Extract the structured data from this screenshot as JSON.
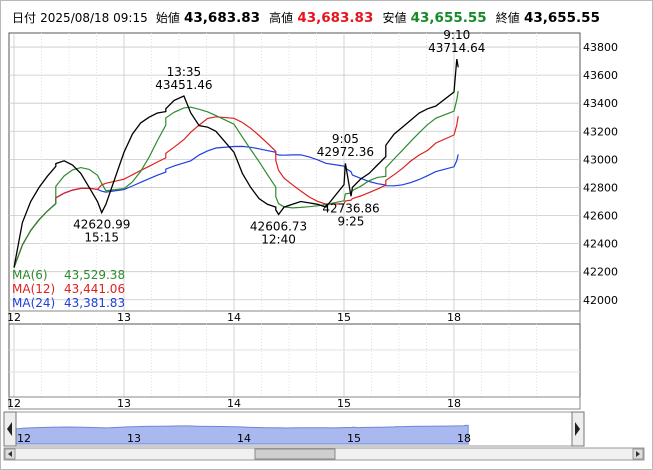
{
  "header": {
    "date_label": "日付",
    "datetime": "2025/08/18 09:15",
    "open_label": "始値",
    "open": "43,683.83",
    "high_label": "高値",
    "high": "43,683.83",
    "low_label": "安値",
    "low": "43,655.55",
    "close_label": "終値",
    "close": "43,655.55"
  },
  "colors": {
    "price": "#000000",
    "ma6": "#2e8b2e",
    "ma12": "#e02020",
    "ma24": "#1f3fe0",
    "navigator_fill": "#aab8f0",
    "grid": "#c8c8c8"
  },
  "legend": [
    {
      "name": "MA(6)",
      "value": "43,529.38",
      "color": "#2e8b2e"
    },
    {
      "name": "MA(12)",
      "value": "43,441.06",
      "color": "#e02020"
    },
    {
      "name": "MA(24)",
      "value": "43,381.83",
      "color": "#1f3fe0"
    }
  ],
  "chart_data": {
    "type": "line",
    "x_type": "intraday",
    "day_labels": [
      "12",
      "13",
      "14",
      "15",
      "18"
    ],
    "y_ticks": [
      42000,
      42200,
      42400,
      42600,
      42800,
      43000,
      43200,
      43400,
      43600,
      43800
    ],
    "ylim": [
      41920,
      43900
    ],
    "grid": true,
    "x": [
      "08/12 09:00",
      "08/12 09:30",
      "08/12 10:00",
      "08/12 10:30",
      "08/12 11:00",
      "08/12 11:30",
      "08/12 12:30",
      "08/12 13:00",
      "08/12 13:30",
      "08/12 14:00",
      "08/12 14:30",
      "08/12 15:00",
      "08/12 15:15",
      "08/12 15:30",
      "08/13 09:00",
      "08/13 09:30",
      "08/13 10:00",
      "08/13 10:30",
      "08/13 11:00",
      "08/13 11:30",
      "08/13 12:30",
      "08/13 13:00",
      "08/13 13:35",
      "08/13 14:00",
      "08/13 14:30",
      "08/13 15:00",
      "08/13 15:30",
      "08/14 09:00",
      "08/14 09:30",
      "08/14 10:00",
      "08/14 10:30",
      "08/14 11:00",
      "08/14 11:30",
      "08/14 12:30",
      "08/14 12:40",
      "08/14 13:00",
      "08/14 13:30",
      "08/14 14:00",
      "08/14 14:30",
      "08/14 15:00",
      "08/14 15:30",
      "08/15 09:00",
      "08/15 09:05",
      "08/15 09:25",
      "08/15 09:30",
      "08/15 10:00",
      "08/15 10:30",
      "08/15 11:00",
      "08/15 11:30",
      "08/15 12:30",
      "08/15 13:00",
      "08/15 13:30",
      "08/15 14:00",
      "08/15 14:30",
      "08/15 15:00",
      "08/15 15:30",
      "08/18 09:00",
      "08/18 09:10",
      "08/18 09:15"
    ],
    "series": [
      {
        "name": "MA(6)",
        "values": null
      },
      {
        "name": "MA(12)",
        "values": null
      },
      {
        "name": "MA(24)",
        "values": null
      }
    ],
    "price": [
      42230,
      42550,
      42700,
      42800,
      42880,
      42950,
      42970,
      42990,
      42960,
      42900,
      42800,
      42700,
      42621,
      42680,
      43050,
      43180,
      43260,
      43300,
      43330,
      43340,
      43360,
      43420,
      43451,
      43330,
      43240,
      43230,
      43200,
      43050,
      42900,
      42800,
      42720,
      42680,
      42660,
      42640,
      42607,
      42660,
      42680,
      42700,
      42690,
      42680,
      42660,
      42820,
      42972,
      42737,
      42800,
      42860,
      42900,
      42960,
      43020,
      43100,
      43180,
      43230,
      43280,
      43330,
      43360,
      43380,
      43480,
      43715,
      43656
    ],
    "annotations": [
      {
        "time": "15:15",
        "value": "42620.99",
        "position": "below"
      },
      {
        "time": "13:35",
        "value": "43451.46",
        "position": "above"
      },
      {
        "time": "12:40",
        "value": "42606.73",
        "position": "below"
      },
      {
        "time": "9:05",
        "value": "42972.36",
        "position": "above"
      },
      {
        "time": "9:25",
        "value": "42736.86",
        "position": "below"
      },
      {
        "time": "9:10",
        "value": "43714.64",
        "position": "above"
      }
    ]
  }
}
